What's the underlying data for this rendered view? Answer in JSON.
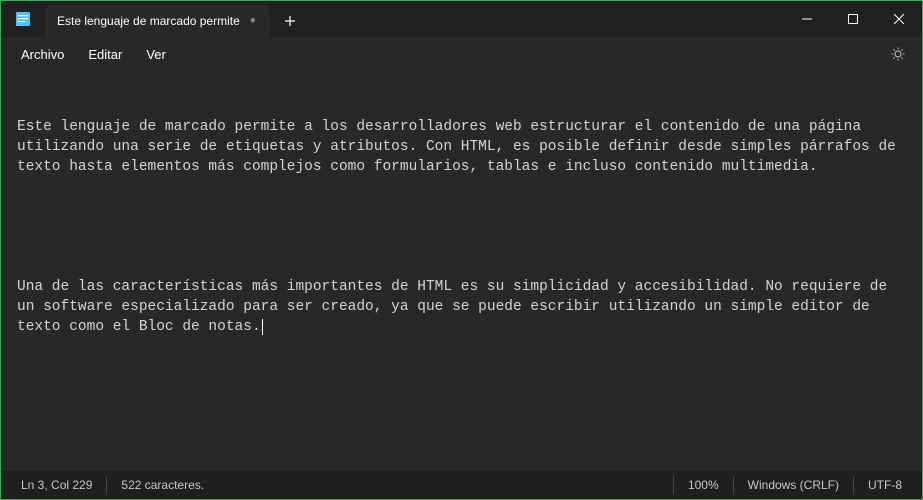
{
  "titlebar": {
    "tab_title": "Este lenguaje de marcado permite",
    "unsaved_indicator": "●",
    "new_tab_label": "+"
  },
  "menubar": {
    "file": "Archivo",
    "edit": "Editar",
    "view": "Ver"
  },
  "editor": {
    "paragraph1": "Este lenguaje de marcado permite a los desarrolladores web estructurar el contenido de una página utilizando una serie de etiquetas y atributos. Con HTML, es posible definir desde simples párrafos de texto hasta elementos más complejos como formularios, tablas e incluso contenido multimedia.",
    "paragraph2": "Una de las características más importantes de HTML es su simplicidad y accesibilidad. No requiere de un software especializado para ser creado, ya que se puede escribir utilizando un simple editor de texto como el Bloc de notas."
  },
  "statusbar": {
    "position": "Ln 3, Col 229",
    "char_count": "522 caracteres.",
    "zoom": "100%",
    "line_ending": "Windows (CRLF)",
    "encoding": "UTF-8"
  }
}
